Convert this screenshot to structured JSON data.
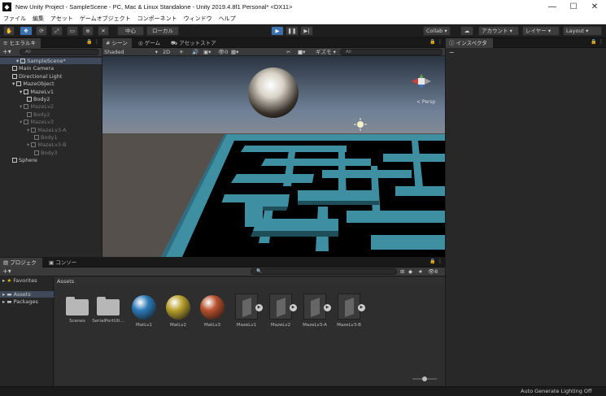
{
  "window": {
    "title": "New Unity Project - SampleScene - PC, Mac & Linux Standalone - Unity 2019.4.8f1 Personal* <DX11>",
    "minimize": "—",
    "maximize": "☐",
    "close": "✕"
  },
  "menu": [
    "ファイル",
    "編集",
    "アセット",
    "ゲームオブジェクト",
    "コンポーネント",
    "ウィンドウ",
    "ヘルプ"
  ],
  "toolbar": {
    "pivot": "中心",
    "space": "ローカル",
    "collab": "Collab",
    "account": "アカウント",
    "layers": "レイヤー",
    "layout": "Layout"
  },
  "hierarchy": {
    "tab": "ヒエラルキー",
    "search_placeholder": "All",
    "items": [
      {
        "label": "SampleScene*",
        "level": 0,
        "dim": false
      },
      {
        "label": "Main Camera",
        "level": 1,
        "dim": false
      },
      {
        "label": "Directional Light",
        "level": 1,
        "dim": false
      },
      {
        "label": "MazeObject",
        "level": 1,
        "dim": false
      },
      {
        "label": "MazeLv1",
        "level": 2,
        "dim": false
      },
      {
        "label": "Body2",
        "level": 3,
        "dim": false
      },
      {
        "label": "MazeLv2",
        "level": 2,
        "dim": true
      },
      {
        "label": "Body2",
        "level": 3,
        "dim": true
      },
      {
        "label": "MazeLv3",
        "level": 2,
        "dim": true
      },
      {
        "label": "MazeLv3-A",
        "level": 3,
        "dim": true
      },
      {
        "label": "Body1",
        "level": 4,
        "dim": true
      },
      {
        "label": "MazeLv3-B",
        "level": 3,
        "dim": true
      },
      {
        "label": "Body3",
        "level": 4,
        "dim": true
      },
      {
        "label": "Sphere",
        "level": 1,
        "dim": false
      }
    ]
  },
  "scene": {
    "tabs": [
      "シーン",
      "ゲーム",
      "アセットストア"
    ],
    "shading": "Shaded",
    "mode2d": "2D",
    "gizmos": "ギズモ",
    "search_placeholder": "All",
    "effects_count": "0",
    "persp_label": "< Persp"
  },
  "inspector": {
    "tab": "インスペクター"
  },
  "project": {
    "tabs": [
      "プロジェクト",
      "コンソール"
    ],
    "favorites": "Favorites",
    "tree": [
      "Assets",
      "Packages"
    ],
    "breadcrumb": "Assets",
    "hidden_count": "8",
    "assets": [
      {
        "label": "Scenes",
        "kind": "folder"
      },
      {
        "label": "SerialPortUti...",
        "kind": "folder"
      },
      {
        "label": "MatLv1",
        "kind": "material",
        "color": "#2c7ab8"
      },
      {
        "label": "MatLv2",
        "kind": "material",
        "color": "#b8a02c"
      },
      {
        "label": "MatLv3",
        "kind": "material",
        "color": "#b8502c"
      },
      {
        "label": "MazeLv1",
        "kind": "prefab"
      },
      {
        "label": "MazeLv2",
        "kind": "prefab"
      },
      {
        "label": "MazeLv3-A",
        "kind": "prefab"
      },
      {
        "label": "MazeLv3-B",
        "kind": "prefab"
      }
    ]
  },
  "status": {
    "text": "Auto Generate Lighting Off"
  },
  "colors": {
    "maze": "#3f8fa3",
    "sky_top": "#2a3340",
    "ground": "#56504d",
    "play_active": "#3a72b0"
  }
}
